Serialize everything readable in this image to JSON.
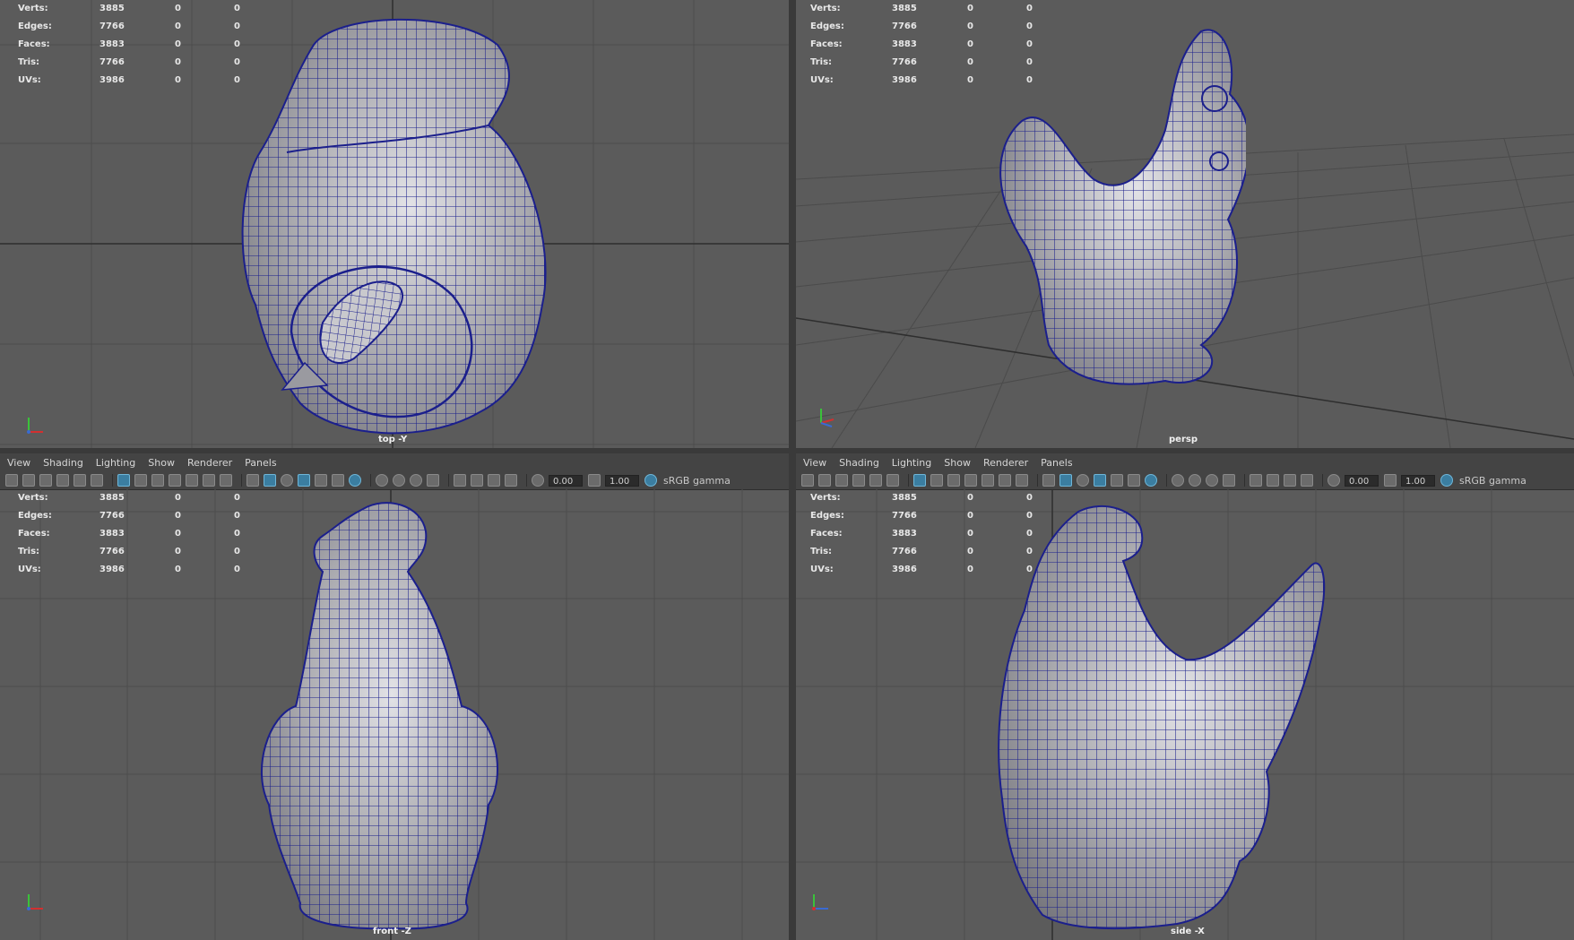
{
  "menu": [
    "View",
    "Shading",
    "Lighting",
    "Show",
    "Renderer",
    "Panels"
  ],
  "toolbar": {
    "exposure": "0.00",
    "gamma": "1.00",
    "color_space": "sRGB gamma"
  },
  "hud": {
    "labels": [
      "Verts:",
      "Edges:",
      "Faces:",
      "Tris:",
      "UVs:"
    ],
    "values": [
      "3885",
      "7766",
      "3883",
      "7766",
      "3986"
    ],
    "zero": "0"
  },
  "viewports": {
    "top": {
      "camera": "top -Y"
    },
    "persp": {
      "camera": "persp"
    },
    "front": {
      "camera": "front -Z"
    },
    "side": {
      "camera": "side -X"
    }
  },
  "colors": {
    "viewport_bg": "#5b5b5b",
    "wireframe": "#1b1f8c",
    "mesh": "#b9b9bd",
    "grid": "#4a4a4a"
  }
}
